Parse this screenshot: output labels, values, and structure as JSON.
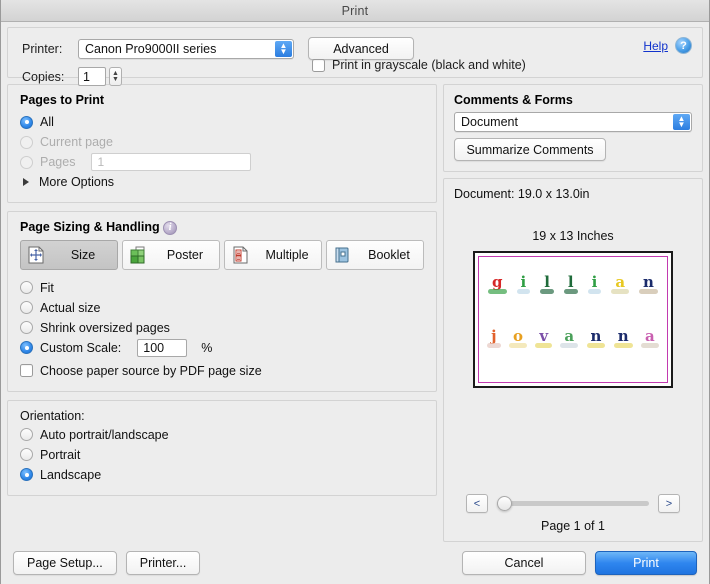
{
  "window": {
    "title": "Print"
  },
  "topbar": {
    "printer_label": "Printer:",
    "printer_value": "Canon Pro9000II series",
    "advanced_label": "Advanced",
    "copies_label": "Copies:",
    "copies_value": "1",
    "grayscale_label": "Print in grayscale (black and white)",
    "help_label": "Help",
    "help_icon_glyph": "?"
  },
  "pages_to_print": {
    "title": "Pages to Print",
    "options": [
      {
        "label": "All",
        "selected": true,
        "disabled": false
      },
      {
        "label": "Current page",
        "selected": false,
        "disabled": true
      },
      {
        "label": "Pages",
        "selected": false,
        "disabled": true
      }
    ],
    "pages_field_value": "1",
    "more_options_label": "More Options"
  },
  "page_sizing": {
    "title": "Page Sizing & Handling",
    "info_icon_glyph": "i",
    "modes": [
      {
        "label": "Size",
        "icon": "resize-page-icon",
        "selected": true
      },
      {
        "label": "Poster",
        "icon": "poster-tiles-icon",
        "selected": false
      },
      {
        "label": "Multiple",
        "icon": "multiple-pages-icon",
        "selected": false
      },
      {
        "label": "Booklet",
        "icon": "booklet-icon",
        "selected": false
      }
    ],
    "options": [
      {
        "label": "Fit",
        "selected": false
      },
      {
        "label": "Actual size",
        "selected": false
      },
      {
        "label": "Shrink oversized pages",
        "selected": false
      },
      {
        "label": "Custom Scale:",
        "selected": true
      }
    ],
    "custom_scale_value": "100",
    "percent_label": "%",
    "paper_source_label": "Choose paper source by PDF page size",
    "paper_source_checked": false
  },
  "orientation": {
    "title": "Orientation:",
    "options": [
      {
        "label": "Auto portrait/landscape",
        "selected": false
      },
      {
        "label": "Portrait",
        "selected": false
      },
      {
        "label": "Landscape",
        "selected": true
      }
    ]
  },
  "comments_forms": {
    "title": "Comments & Forms",
    "selected": "Document",
    "summarize_label": "Summarize Comments"
  },
  "preview": {
    "document_line": "Document: 19.0 x 13.0in",
    "size_caption": "19 x 13 Inches",
    "artwork": {
      "row1": [
        {
          "char": "g",
          "color": "#d62828",
          "base": "#3aa34a"
        },
        {
          "char": "i",
          "color": "#2f9e44",
          "base": "#bfd8e8"
        },
        {
          "char": "l",
          "color": "#1f6b3a",
          "base": "#2c6e49"
        },
        {
          "char": "l",
          "color": "#1f6b3a",
          "base": "#2c6e49"
        },
        {
          "char": "i",
          "color": "#2f9e44",
          "base": "#bfd8e8"
        },
        {
          "char": "a",
          "color": "#e8c820",
          "base": "#dcd6a8"
        },
        {
          "char": "n",
          "color": "#1b2b6b",
          "base": "#c9b9a0"
        }
      ],
      "row2": [
        {
          "char": "j",
          "color": "#e2622c",
          "base": "#e6c8c0"
        },
        {
          "char": "o",
          "color": "#e8a020",
          "base": "#efe0a0"
        },
        {
          "char": "v",
          "color": "#7b4fa8",
          "base": "#e8d86a"
        },
        {
          "char": "a",
          "color": "#4aa05a",
          "base": "#cfd9df"
        },
        {
          "char": "n",
          "color": "#1b2b6b",
          "base": "#e8d86a"
        },
        {
          "char": "n",
          "color": "#1b2b6b",
          "base": "#e8d86a"
        },
        {
          "char": "a",
          "color": "#c95fb0",
          "base": "#d8cfc0"
        }
      ]
    },
    "prev_arrow": "<",
    "next_arrow": ">",
    "page_label": "Page 1 of 1"
  },
  "footer": {
    "page_setup_label": "Page Setup...",
    "printer_label": "Printer...",
    "cancel_label": "Cancel",
    "print_label": "Print"
  }
}
